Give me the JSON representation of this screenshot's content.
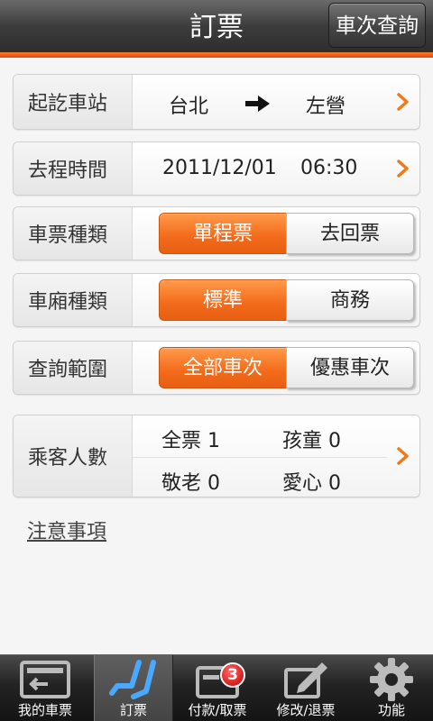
{
  "header": {
    "title": "訂票",
    "query_button": "車次查詢"
  },
  "colors": {
    "accent": "#f26a1a",
    "header_bg": "#3c3c3c"
  },
  "stations": {
    "label": "起訖車站",
    "from": "台北",
    "to": "左營"
  },
  "departure": {
    "label": "去程時間",
    "date": "2011/12/01",
    "time": "06:30"
  },
  "ticket_type": {
    "label": "車票種類",
    "options": [
      "單程票",
      "去回票"
    ],
    "selected": "單程票"
  },
  "car_type": {
    "label": "車廂種類",
    "options": [
      "標準",
      "商務"
    ],
    "selected": "標準"
  },
  "query_range": {
    "label": "查詢範圍",
    "options": [
      "全部車次",
      "優惠車次"
    ],
    "selected": "全部車次"
  },
  "passengers": {
    "label": "乘客人數",
    "adult": "全票 1",
    "child": "孩童 0",
    "senior": "敬老 0",
    "disabled": "愛心 0"
  },
  "notice_link": "注意事項",
  "tabs": [
    {
      "label": "我的車票",
      "icon": "ticket-icon"
    },
    {
      "label": "訂票",
      "icon": "seat-icon"
    },
    {
      "label": "付款/取票",
      "icon": "payment-icon",
      "badge": "3"
    },
    {
      "label": "修改/退票",
      "icon": "edit-icon"
    },
    {
      "label": "功能",
      "icon": "gear-icon"
    }
  ],
  "active_tab": "訂票"
}
